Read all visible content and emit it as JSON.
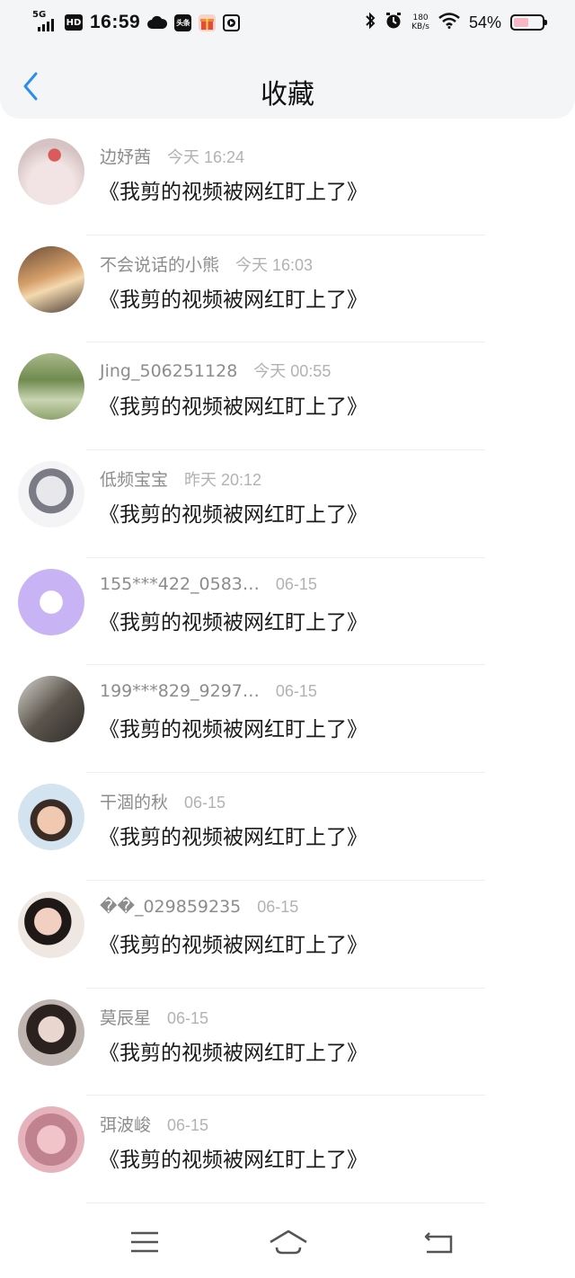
{
  "status_bar": {
    "network": "5G",
    "hd": "HD",
    "time": "16:59",
    "app_icons": [
      "cloud-icon",
      "toutiao-icon",
      "gift-icon",
      "play-icon"
    ],
    "news_label": "头条",
    "speed_value": "180",
    "speed_unit": "KB/s",
    "battery_percent": "54%",
    "battery_level": 0.54
  },
  "header": {
    "title": "收藏",
    "back_icon": "chevron-left-icon",
    "accent_color": "#2d8cf0"
  },
  "favorites": [
    {
      "user": "边妤茜",
      "time": "今天 16:24",
      "title": "《我剪的视频被网红盯上了》"
    },
    {
      "user": "不会说话的小熊",
      "time": "今天 16:03",
      "title": "《我剪的视频被网红盯上了》"
    },
    {
      "user": "Jing_506251128",
      "time": "今天 00:55",
      "title": "《我剪的视频被网红盯上了》"
    },
    {
      "user": "低频宝宝",
      "time": "昨天 20:12",
      "title": "《我剪的视频被网红盯上了》"
    },
    {
      "user": "155***422_0583…",
      "time": "06-15",
      "title": "《我剪的视频被网红盯上了》"
    },
    {
      "user": "199***829_9297…",
      "time": "06-15",
      "title": "《我剪的视频被网红盯上了》"
    },
    {
      "user": "干涸的秋",
      "time": "06-15",
      "title": "《我剪的视频被网红盯上了》"
    },
    {
      "user": "��_029859235",
      "time": "06-15",
      "title": "《我剪的视频被网红盯上了》"
    },
    {
      "user": "莫辰星",
      "time": "06-15",
      "title": "《我剪的视频被网红盯上了》"
    },
    {
      "user": "弭波峻",
      "time": "06-15",
      "title": "《我剪的视频被网红盯上了》"
    }
  ],
  "nav_bar": {
    "icons": [
      "menu-icon",
      "home-icon",
      "back-icon"
    ]
  }
}
